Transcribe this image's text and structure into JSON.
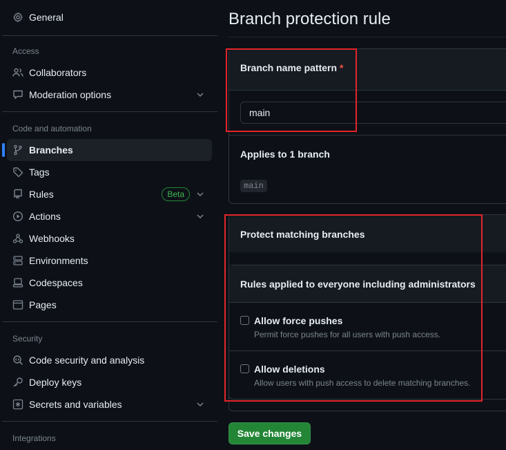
{
  "sidebar": {
    "general": "General",
    "sections": {
      "access": "Access",
      "code_automation": "Code and automation",
      "security": "Security",
      "integrations": "Integrations"
    },
    "collaborators": "Collaborators",
    "moderation": "Moderation options",
    "branches": "Branches",
    "tags": "Tags",
    "rules": "Rules",
    "rules_badge": "Beta",
    "actions": "Actions",
    "webhooks": "Webhooks",
    "environments": "Environments",
    "codespaces": "Codespaces",
    "pages": "Pages",
    "code_security": "Code security and analysis",
    "deploy_keys": "Deploy keys",
    "secrets": "Secrets and variables"
  },
  "main": {
    "title": "Branch protection rule",
    "pattern_label": "Branch name pattern",
    "required_mark": "*",
    "pattern_value": "main",
    "applies_text": "Applies to 1 branch",
    "applies_branch": "main",
    "protect_heading": "Protect matching branches",
    "rules_heading": "Rules applied to everyone including administrators",
    "force_push_label": "Allow force pushes",
    "force_push_desc": "Permit force pushes for all users with push access.",
    "deletions_label": "Allow deletions",
    "deletions_desc": "Allow users with push access to delete matching branches.",
    "save_button": "Save changes"
  },
  "colors": {
    "accent_blue": "#2f81f7",
    "save_green": "#238636",
    "highlight_red": "#e5242b"
  }
}
